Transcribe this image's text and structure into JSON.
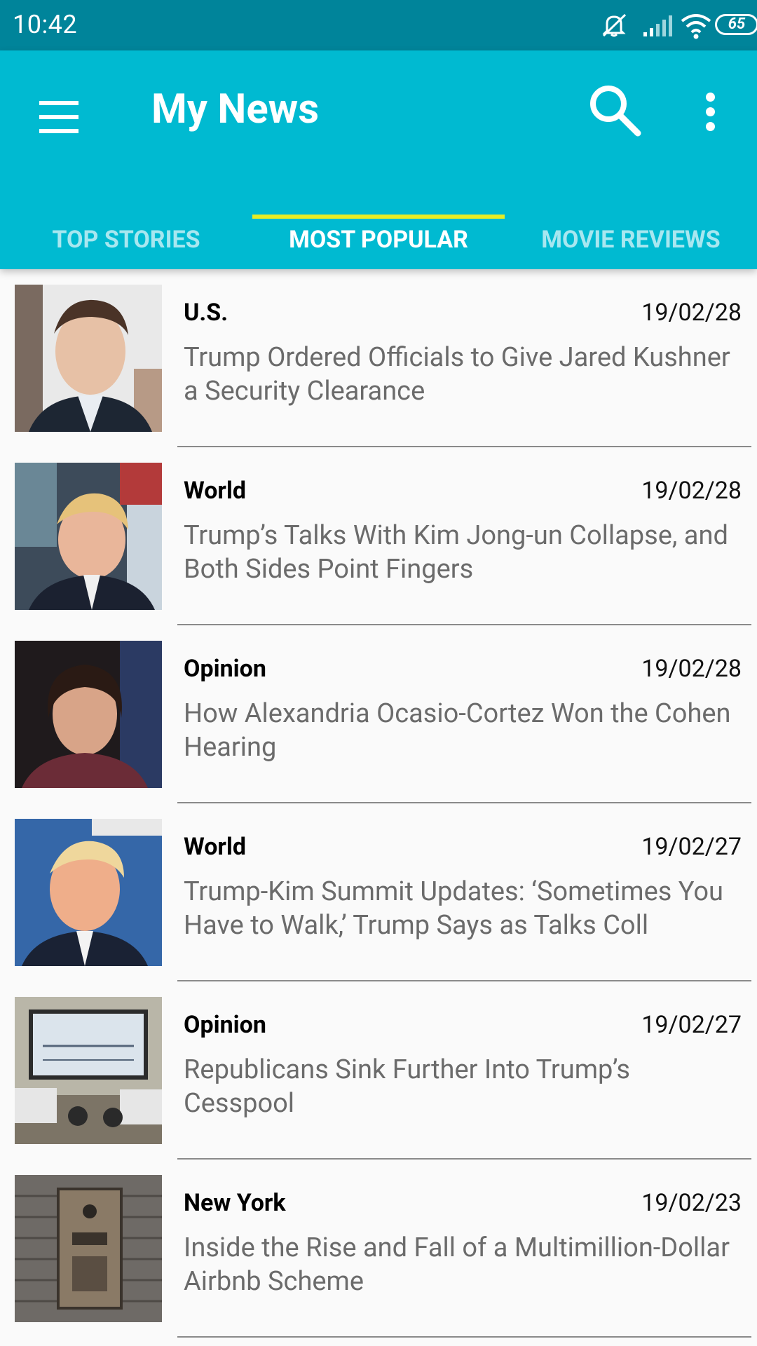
{
  "status_bar": {
    "time": "10:42",
    "battery": "65",
    "icons": [
      "notifications-off-icon",
      "signal-icon",
      "wifi-icon",
      "battery-icon"
    ]
  },
  "app_bar": {
    "title": "My News",
    "icons": [
      "menu-icon",
      "search-icon",
      "more-vert-icon"
    ],
    "background_color": "#00bad1",
    "status_color": "#00849a",
    "indicator_color": "#e6ed25"
  },
  "tabs": [
    {
      "label": "TOP STORIES",
      "active": false
    },
    {
      "label": "MOST POPULAR",
      "active": true
    },
    {
      "label": "MOVIE REVIEWS",
      "active": false
    }
  ],
  "articles": [
    {
      "section": "U.S.",
      "date": "19/02/28",
      "title": "Trump Ordered Officials to Give Jared Kushner a Security Clearance",
      "thumbnail": "portrait-photo"
    },
    {
      "section": "World",
      "date": "19/02/28",
      "title": "Trump’s Talks With Kim Jong-un Collapse, and Both Sides Point Fingers",
      "thumbnail": "portrait-photo"
    },
    {
      "section": "Opinion",
      "date": "19/02/28",
      "title": "How Alexandria Ocasio-Cortez Won the Cohen Hearing",
      "thumbnail": "portrait-photo"
    },
    {
      "section": "World",
      "date": "19/02/27",
      "title": "Trump-Kim Summit Updates: ‘Sometimes You Have to Walk,’ Trump Says as Talks Coll",
      "thumbnail": "portrait-photo"
    },
    {
      "section": "Opinion",
      "date": "19/02/27",
      "title": "Republicans Sink Further Into Trump’s Cesspool",
      "thumbnail": "hearing-room-photo"
    },
    {
      "section": "New York",
      "date": "19/02/23",
      "title": "Inside the Rise and Fall of a Multimillion-Dollar Airbnb Scheme",
      "thumbnail": "intercom-panel-photo"
    }
  ]
}
